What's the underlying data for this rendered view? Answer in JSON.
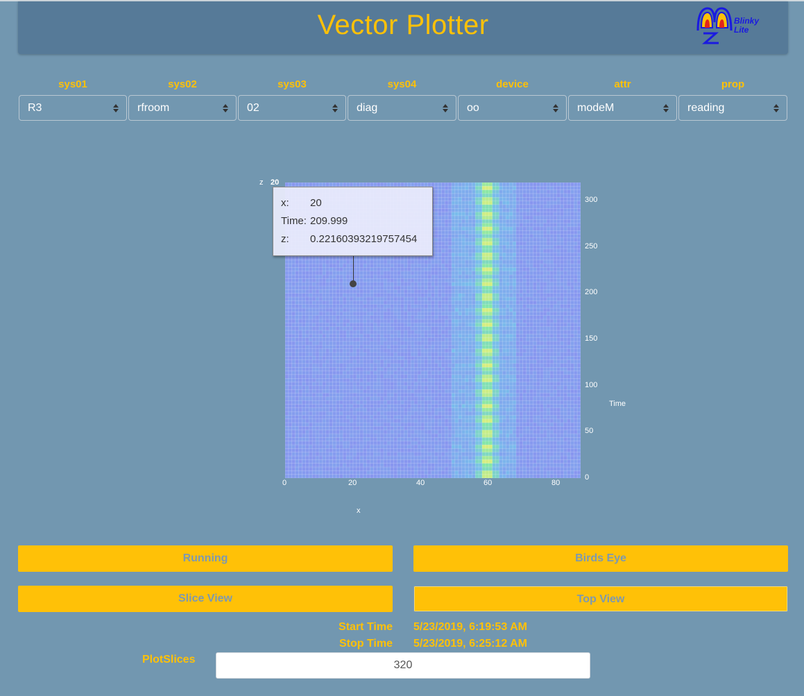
{
  "header": {
    "title": "Vector Plotter",
    "logo_text_1": "Blinky",
    "logo_text_2": "Lite"
  },
  "selectors": [
    {
      "label": "sys01",
      "value": "R3"
    },
    {
      "label": "sys02",
      "value": "rfroom"
    },
    {
      "label": "sys03",
      "value": "02"
    },
    {
      "label": "sys04",
      "value": "diag"
    },
    {
      "label": "device",
      "value": "oo"
    },
    {
      "label": "attr",
      "value": "modeM"
    },
    {
      "label": "prop",
      "value": "reading"
    }
  ],
  "plot": {
    "z_axis_label": "z",
    "z_axis_ticks": "20",
    "x_axis_label": "x",
    "y_axis_label": "Time",
    "x_ticks": [
      "0",
      "20",
      "40",
      "60",
      "80"
    ],
    "y_ticks": [
      "0",
      "50",
      "100",
      "150",
      "200",
      "250",
      "300"
    ],
    "tooltip": {
      "x_key": "x:",
      "x_val": "20",
      "time_key": "Time:",
      "time_val": "209.999",
      "z_key": "z:",
      "z_val": "0.22160393219757454"
    }
  },
  "chart_data": {
    "type": "heatmap",
    "x_range": [
      0,
      87
    ],
    "y_range": [
      0,
      320
    ],
    "xlabel": "x",
    "ylabel": "Time",
    "bright_band_x": 59,
    "hover_point": {
      "x": 20,
      "time": 209.999,
      "z": 0.22160393219757454
    }
  },
  "controls": {
    "running_label": "Running",
    "birds_eye_label": "Birds Eye",
    "slice_view_label": "Slice View",
    "top_view_label": "Top View"
  },
  "times": {
    "start_label": "Start Time",
    "start_value": "5/23/2019, 6:19:53 AM",
    "stop_label": "Stop Time",
    "stop_value": "5/23/2019, 6:25:12 AM"
  },
  "plotslices": {
    "label": "PlotSlices",
    "value": "320"
  },
  "colors": {
    "accent": "#ffc107",
    "background": "#7297b0",
    "header": "#567a98"
  }
}
